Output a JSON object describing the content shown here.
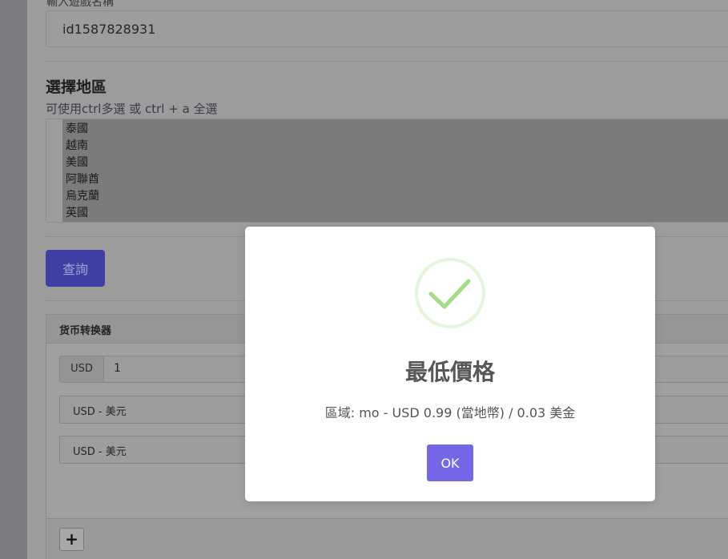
{
  "form": {
    "game_label": "輸入遊戲名稱",
    "game_value": "id1587828931",
    "region_title": "選擇地區",
    "region_hint": "可使用ctrl多選 或 ctrl + a 全選",
    "regions": [
      "泰國",
      "越南",
      "美國",
      "阿聯酋",
      "烏克蘭",
      "英國"
    ],
    "query_label": "查詢"
  },
  "converter": {
    "title": "货币转换器",
    "amount_currency": "USD",
    "amount_value": "1",
    "from_currency": "USD - 美元",
    "to_currency": "USD - 美元",
    "add_label": "+"
  },
  "modal": {
    "title": "最低價格",
    "text": "區域: mo - USD 0.99 (當地幣) / 0.03 美金",
    "ok_label": "OK",
    "icon": "check-circle-icon",
    "accent_color": "#a5dc86",
    "button_color": "#7467e6"
  }
}
